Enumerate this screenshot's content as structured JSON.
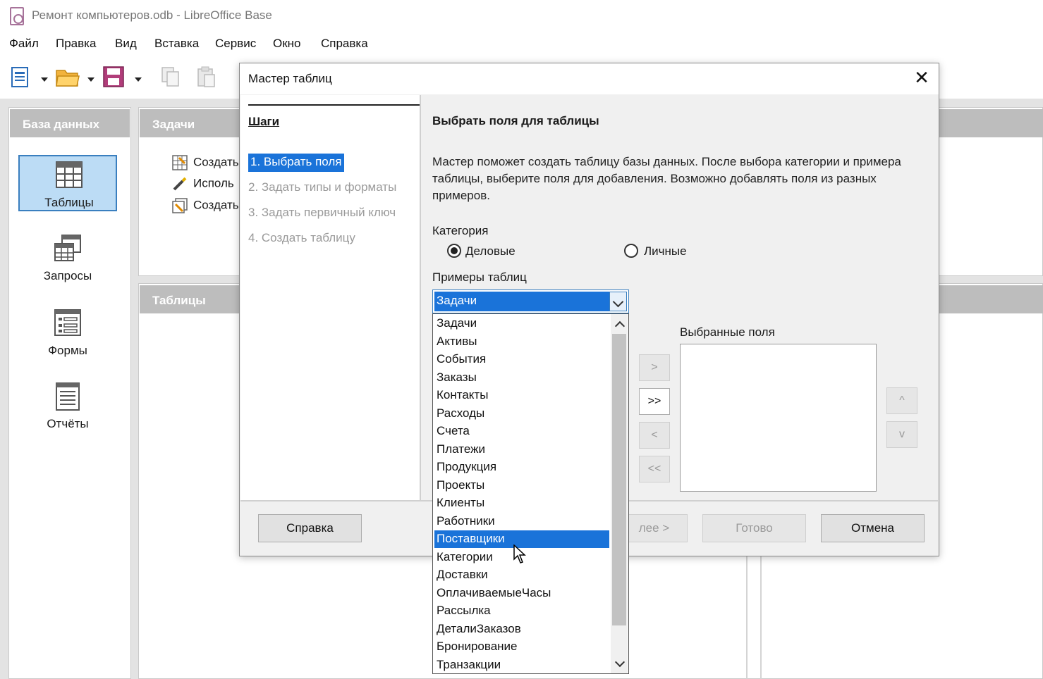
{
  "window": {
    "title": "Ремонт компьютеров.odb - LibreOffice Base"
  },
  "menu": [
    "Файл",
    "Правка",
    "Вид",
    "Вставка",
    "Сервис",
    "Окно",
    "Справка"
  ],
  "toolbar": {
    "icons": [
      "new-document-icon",
      "open-folder-icon",
      "save-icon",
      "copy-icon",
      "paste-icon"
    ]
  },
  "left_panel": {
    "header": "База данных",
    "items": [
      {
        "label": "Таблицы",
        "icon": "table-icon",
        "selected": true
      },
      {
        "label": "Запросы",
        "icon": "query-icon",
        "selected": false
      },
      {
        "label": "Формы",
        "icon": "form-icon",
        "selected": false
      },
      {
        "label": "Отчёты",
        "icon": "report-icon",
        "selected": false
      }
    ]
  },
  "tasks_panel": {
    "header": "Задачи",
    "rows": [
      "Создать",
      "Исполь",
      "Создать"
    ]
  },
  "tables_panel": {
    "header": "Таблицы"
  },
  "dialog": {
    "title": "Мастер таблиц",
    "close_glyph": "✕",
    "steps_heading": "Шаги",
    "steps": [
      {
        "label": "1. Выбрать поля",
        "active": true
      },
      {
        "label": "2. Задать типы и форматы",
        "active": false
      },
      {
        "label": "3. Задать первичный ключ",
        "active": false
      },
      {
        "label": "4. Создать таблицу",
        "active": false
      }
    ],
    "page_heading": "Выбрать поля для таблицы",
    "description": "Мастер поможет создать таблицу базы данных. После выбора категории и примера таблицы, выберите поля для добавления. Возможно добавлять поля из разных примеров.",
    "category_label": "Категория",
    "category_options": [
      {
        "label": "Деловые",
        "checked": true
      },
      {
        "label": "Личные",
        "checked": false
      }
    ],
    "examples_label": "Примеры таблиц",
    "examples_selected": "Задачи",
    "dropdown_items": [
      "Задачи",
      "Активы",
      "События",
      "Заказы",
      "Контакты",
      "Расходы",
      "Счета",
      "Платежи",
      "Продукция",
      "Проекты",
      "Клиенты",
      "Работники",
      "Поставщики",
      "Категории",
      "Доставки",
      "ОплачиваемыеЧасы",
      "Рассылка",
      "ДеталиЗаказов",
      "Бронирование",
      "Транзакции"
    ],
    "dropdown_highlighted": "Поставщики",
    "selected_fields_label": "Выбранные поля",
    "move_buttons": [
      ">",
      ">>",
      "<",
      "<<"
    ],
    "order_buttons": [
      "^",
      "v"
    ],
    "buttons": {
      "help": "Справка",
      "next": "лее >",
      "finish": "Готово",
      "cancel": "Отмена"
    }
  }
}
